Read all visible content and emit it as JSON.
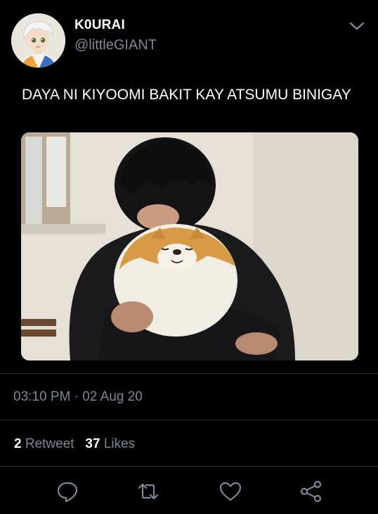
{
  "user": {
    "display_name": "K0URAI",
    "handle": "@littleGIANT",
    "avatar_icon": "avatar-anime-character"
  },
  "tweet": {
    "text": "DAYA NI KIYOOMI BAKIT KAY ATSUMU BINIGAY",
    "time": "03:10 PM",
    "separator": "·",
    "date": "02 Aug 20"
  },
  "stats": {
    "retweets": "2",
    "retweets_label": "Retweet",
    "likes": "37",
    "likes_label": "Likes"
  },
  "actions": [
    {
      "icon": "reply-icon"
    },
    {
      "icon": "retweet-icon"
    },
    {
      "icon": "like-heart-icon"
    },
    {
      "icon": "share-icon"
    }
  ],
  "colors": {
    "background": "#000000",
    "secondary_text": "#7b8895",
    "divider": "#2f3336"
  }
}
